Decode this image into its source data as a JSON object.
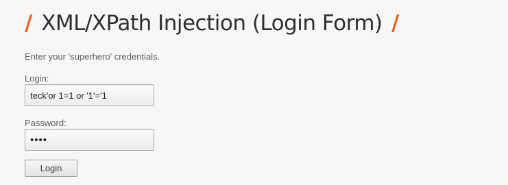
{
  "header": {
    "slash_left": "/",
    "title": "XML/XPath Injection (Login Form)",
    "slash_right": "/"
  },
  "form": {
    "intro": "Enter your 'superhero' credentials.",
    "login_label": "Login:",
    "login_value": "teck'or 1=1 or '1'='1",
    "password_label": "Password:",
    "password_value": "1234",
    "submit_label": "Login"
  },
  "colors": {
    "accent": "#e8602c",
    "title": "#2f2f2f",
    "background": "#f7f7f7"
  }
}
